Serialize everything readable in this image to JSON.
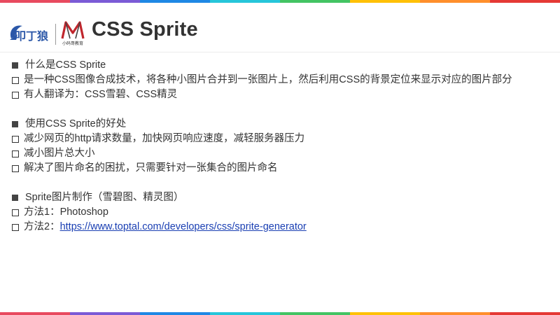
{
  "colors": {
    "rainbow": [
      "#e84a5f",
      "#7b5bd6",
      "#1e88e5",
      "#26c6da",
      "#43c463",
      "#ffc107",
      "#ff8f2c",
      "#e53935"
    ],
    "link": "#1a3fb3",
    "text": "#333333"
  },
  "header": {
    "title": "CSS Sprite",
    "logo_left_text": "叩丁狼",
    "logo_right_text": "小码哥教育"
  },
  "sections": [
    {
      "heading": "什么是CSS Sprite",
      "items": [
        "是一种CSS图像合成技术，将各种小图片合并到一张图片上，然后利用CSS的背景定位来显示对应的图片部分",
        "有人翻译为：CSS雪碧、CSS精灵"
      ]
    },
    {
      "heading": "使用CSS Sprite的好处",
      "items": [
        "减少网页的http请求数量，加快网页响应速度，减轻服务器压力",
        "减小图片总大小",
        "解决了图片命名的困扰，只需要针对一张集合的图片命名"
      ]
    },
    {
      "heading": "Sprite图片制作（雪碧图、精灵图）",
      "items": [
        "方法1：Photoshop"
      ],
      "link_item": {
        "prefix": "方法2：",
        "url_text": "https://www.toptal.com/developers/css/sprite-generator"
      }
    }
  ]
}
